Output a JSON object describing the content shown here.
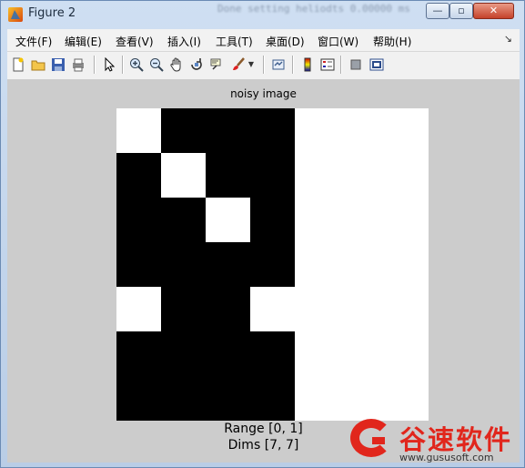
{
  "window": {
    "title": "Figure 2",
    "background_text": "Done setting heliodts 0.00000 ms",
    "controls": {
      "minimize": "—",
      "maximize": "▫",
      "close": "✕"
    }
  },
  "menubar": {
    "items": [
      "文件(F)",
      "编辑(E)",
      "查看(V)",
      "插入(I)",
      "工具(T)",
      "桌面(D)",
      "窗口(W)",
      "帮助(H)"
    ],
    "overflow": "↘"
  },
  "toolbar": {
    "icons": [
      "new-figure-icon",
      "open-folder-icon",
      "save-icon",
      "print-icon",
      "pointer-icon",
      "zoom-in-icon",
      "zoom-out-icon",
      "pan-hand-icon",
      "rotate-3d-icon",
      "data-cursor-icon",
      "brush-icon",
      "brush-dropdown-icon",
      "link-plot-icon",
      "colorbar-icon",
      "legend-icon",
      "hide-plot-tools-icon",
      "show-plot-tools-icon"
    ]
  },
  "figure": {
    "title": "noisy image",
    "range_label": "Range [0, 1]",
    "dims_label": "Dims [7, 7]",
    "pixels": [
      [
        1,
        0,
        0,
        0,
        1,
        1,
        1
      ],
      [
        0,
        1,
        0,
        0,
        1,
        1,
        1
      ],
      [
        0,
        0,
        1,
        0,
        1,
        1,
        1
      ],
      [
        0,
        0,
        0,
        0,
        1,
        1,
        1
      ],
      [
        1,
        0,
        0,
        1,
        1,
        1,
        1
      ],
      [
        0,
        0,
        0,
        0,
        1,
        1,
        1
      ],
      [
        0,
        0,
        0,
        0,
        1,
        1,
        1
      ]
    ],
    "colors": {
      "one": "#ffffff",
      "zero": "#000000",
      "background": "#cccccc"
    }
  },
  "watermark": {
    "text": "谷速软件",
    "url": "www.gususoft.com"
  }
}
